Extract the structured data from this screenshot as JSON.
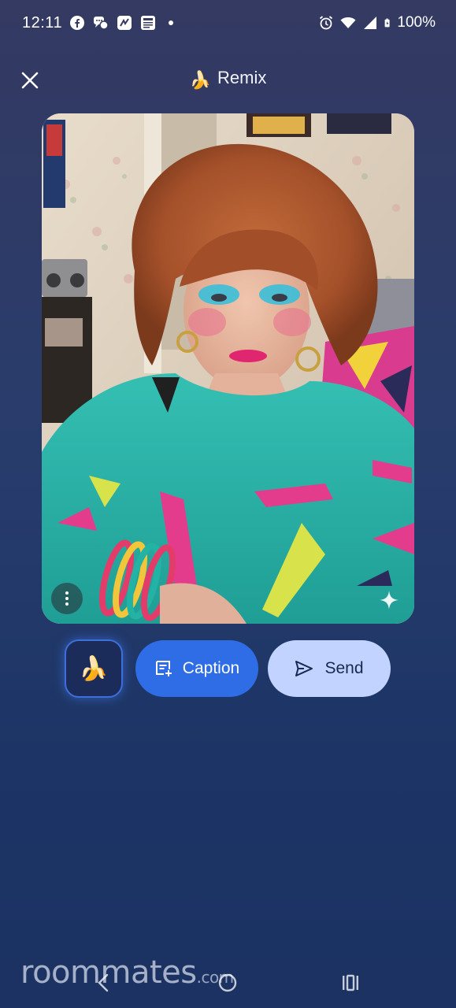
{
  "status_bar": {
    "time": "12:11",
    "notification_icons": [
      "facebook-icon",
      "messenger-chat-icon",
      "nova-app-icon",
      "news-icon"
    ],
    "battery_percent": "100%",
    "system_icons": [
      "alarm-icon",
      "wifi-icon",
      "signal-icon",
      "battery-icon"
    ]
  },
  "header": {
    "title_emoji": "🍌",
    "title": "Remix"
  },
  "photo": {
    "description_icon": "photo-image",
    "more_options_icon": "more-vert-icon",
    "ai_mark_icon": "sparkle-icon"
  },
  "actions": {
    "remix_chip_emoji": "🍌",
    "caption_label": "Caption",
    "send_label": "Send"
  },
  "watermark": {
    "brand": "roommates",
    "tld": ".com"
  },
  "nav": {
    "back_icon": "back-icon",
    "home_icon": "home-icon",
    "recents_icon": "recents-icon"
  },
  "colors": {
    "background_top": "#343a62",
    "background_bottom": "#1b3262",
    "caption_button": "#2f6de6",
    "send_button": "#c2d3ff",
    "remix_chip_border": "#3e6ed9"
  }
}
